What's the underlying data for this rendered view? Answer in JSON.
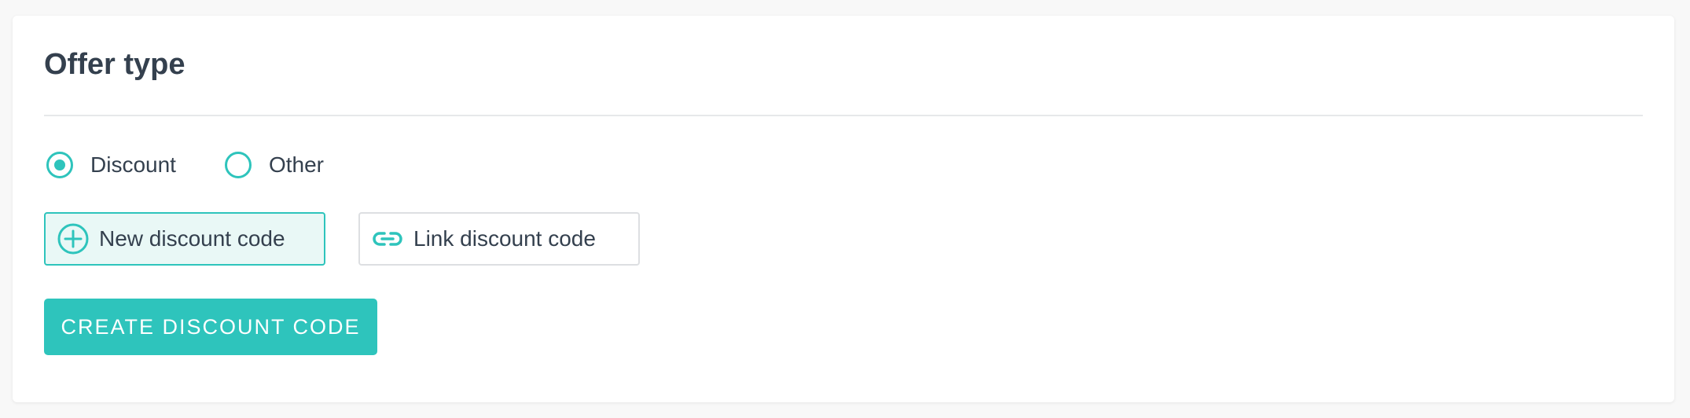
{
  "card": {
    "title": "Offer type"
  },
  "offer_type": {
    "options": [
      {
        "label": "Discount",
        "selected": true
      },
      {
        "label": "Other",
        "selected": false
      }
    ]
  },
  "discount_mode": {
    "new_code": {
      "label": "New discount code",
      "icon": "plus-circle-icon",
      "selected": true
    },
    "link_code": {
      "label": "Link discount code",
      "icon": "link-icon",
      "selected": false
    }
  },
  "actions": {
    "create_label": "Create discount code"
  },
  "colors": {
    "accent": "#2ec4bc",
    "accent_light": "#e9f8f6",
    "text": "#34404e",
    "border": "#dddfe2"
  }
}
